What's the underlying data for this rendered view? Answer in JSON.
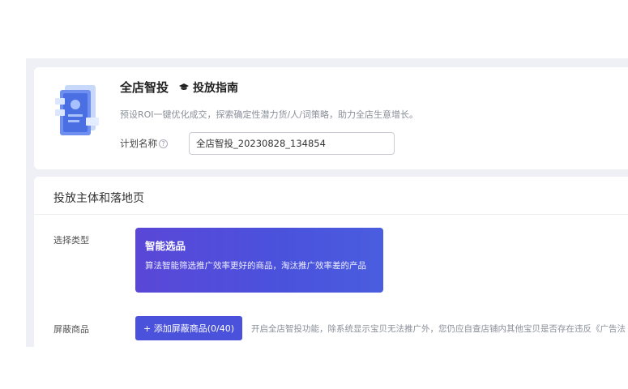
{
  "header": {
    "title": "全店智投",
    "guide_label": "投放指南",
    "subtitle": "预设ROI一键优化成交，探索确定性潜力货/人/词策略，助力全店生意增长。",
    "plan_label": "计划名称",
    "plan_value": "全店智投_20230828_134854"
  },
  "section": {
    "title": "投放主体和落地页",
    "type_label": "选择类型",
    "type_card": {
      "title": "智能选品",
      "desc": "算法智能筛选推广效率更好的商品，淘汰推广效率差的产品"
    },
    "block_label": "屏蔽商品",
    "add_button": "+  添加屏蔽商品(0/40)",
    "hint": "开启全店智投功能，除系统显示宝贝无法推广外，您仍应自查店铺内其他宝贝是否存在违反《广告法"
  }
}
